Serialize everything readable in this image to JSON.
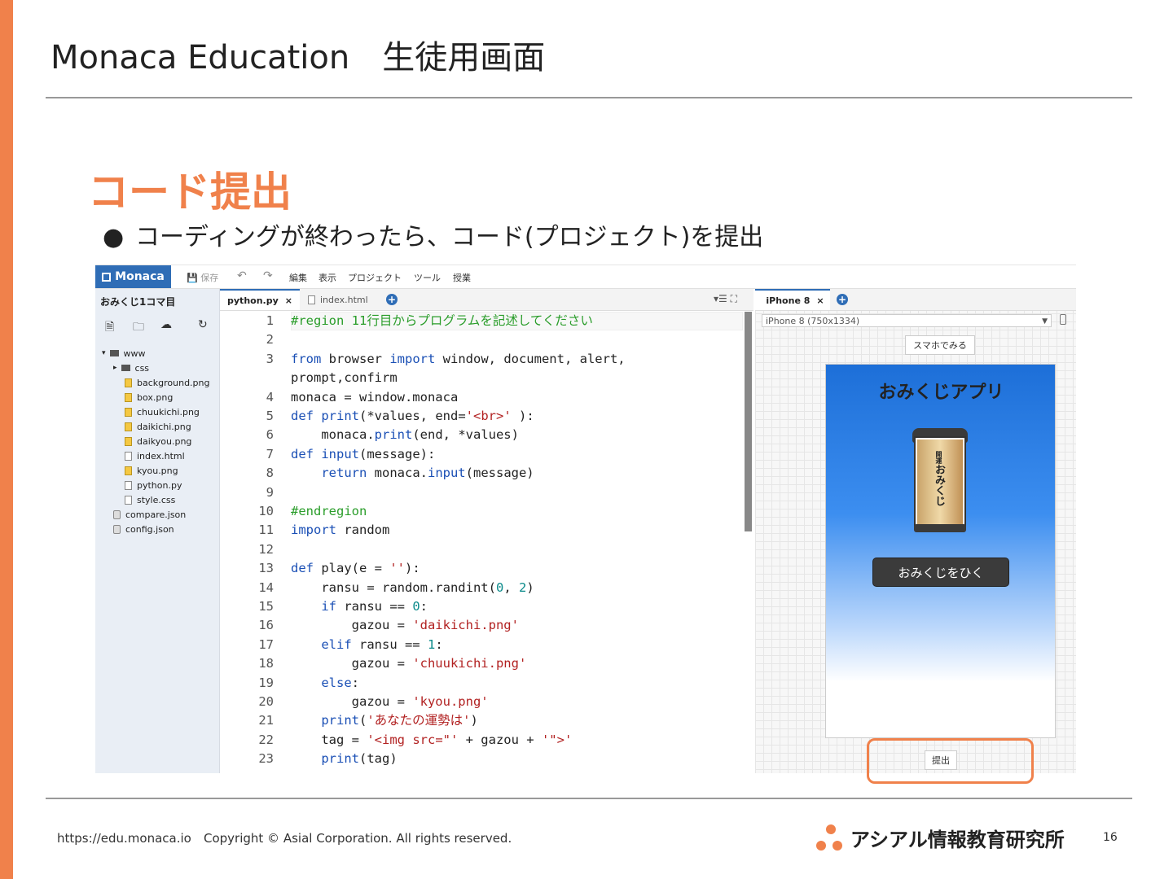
{
  "slide": {
    "title": "Monaca Education　生徒用画面",
    "section_title": "コード提出",
    "bullet": "コーディングが終わったら、コード(プロジェクト)を提出",
    "bullet_mark": "●",
    "page_number": "16"
  },
  "footer": {
    "url": "https://edu.monaca.io",
    "copyright": "Copyright © Asial Corporation. All rights reserved.",
    "logo_text": "アシアル情報教育研究所"
  },
  "ide": {
    "brand": "Monaca",
    "save_label": "保存",
    "menu": [
      "編集",
      "表示",
      "プロジェクト",
      "ツール",
      "授業"
    ],
    "project_name": "おみくじ1コマ目",
    "tree": [
      {
        "name": "www",
        "type": "folder",
        "depth": 0
      },
      {
        "name": "css",
        "type": "folder",
        "depth": 1
      },
      {
        "name": "background.png",
        "type": "img",
        "depth": 2
      },
      {
        "name": "box.png",
        "type": "img",
        "depth": 2
      },
      {
        "name": "chuukichi.png",
        "type": "img",
        "depth": 2
      },
      {
        "name": "daikichi.png",
        "type": "img",
        "depth": 2
      },
      {
        "name": "daikyou.png",
        "type": "img",
        "depth": 2
      },
      {
        "name": "index.html",
        "type": "file",
        "depth": 2
      },
      {
        "name": "kyou.png",
        "type": "img",
        "depth": 2
      },
      {
        "name": "python.py",
        "type": "file",
        "depth": 2
      },
      {
        "name": "style.css",
        "type": "file",
        "depth": 2
      },
      {
        "name": "compare.json",
        "type": "gear",
        "depth": 1
      },
      {
        "name": "config.json",
        "type": "gear",
        "depth": 1
      }
    ],
    "tabs": [
      {
        "label": "python.py",
        "close": "×"
      },
      {
        "label": "index.html"
      }
    ],
    "code": [
      {
        "n": "1",
        "html": "<span class=\"cm\">#region 11行目からプログラムを記述してください</span>"
      },
      {
        "n": "2",
        "html": ""
      },
      {
        "n": "3",
        "html": "<span class=\"kw\">from</span> browser <span class=\"kw\">import</span> window, document, alert,"
      },
      {
        "n": "",
        "html": "prompt,confirm"
      },
      {
        "n": "4",
        "html": "monaca = window.monaca"
      },
      {
        "n": "5",
        "html": "<span class=\"kw\">def</span> <span class=\"kw\">print</span>(*values, end=<span class=\"st\">'&lt;br&gt;'</span> ):"
      },
      {
        "n": "6",
        "html": "    monaca.<span class=\"kw\">print</span>(end, *values)"
      },
      {
        "n": "7",
        "html": "<span class=\"kw\">def</span> <span class=\"kw\">input</span>(message):"
      },
      {
        "n": "8",
        "html": "    <span class=\"kw\">return</span> monaca.<span class=\"kw\">input</span>(message)"
      },
      {
        "n": "9",
        "html": ""
      },
      {
        "n": "10",
        "html": "<span class=\"cm\">#endregion</span>"
      },
      {
        "n": "11",
        "html": "<span class=\"kw\">import</span> random"
      },
      {
        "n": "12",
        "html": ""
      },
      {
        "n": "13",
        "html": "<span class=\"kw\">def</span> play(e = <span class=\"st\">''</span>):"
      },
      {
        "n": "14",
        "html": "    ransu = random.randint(<span class=\"nm\">0</span>, <span class=\"nm\">2</span>)"
      },
      {
        "n": "15",
        "html": "    <span class=\"kw\">if</span> ransu == <span class=\"nm\">0</span>:"
      },
      {
        "n": "16",
        "html": "        gazou = <span class=\"st\">'daikichi.png'</span>"
      },
      {
        "n": "17",
        "html": "    <span class=\"kw\">elif</span> ransu == <span class=\"nm\">1</span>:"
      },
      {
        "n": "18",
        "html": "        gazou = <span class=\"st\">'chuukichi.png'</span>"
      },
      {
        "n": "19",
        "html": "    <span class=\"kw\">else</span>:"
      },
      {
        "n": "20",
        "html": "        gazou = <span class=\"st\">'kyou.png'</span>"
      },
      {
        "n": "21",
        "html": "    <span class=\"kw\">print</span>(<span class=\"st\">'あなたの運勢は'</span>)"
      },
      {
        "n": "22",
        "html": "    tag = <span class=\"st\">'&lt;img src=\"'</span> + gazou + <span class=\"st\">'\"&gt;'</span>"
      },
      {
        "n": "23",
        "html": "    <span class=\"kw\">print</span>(tag)"
      }
    ],
    "preview": {
      "tab_label": "iPhone 8",
      "tab_close": "×",
      "device": "iPhone 8 (750x1334)",
      "view_on_phone": "スマホでみる",
      "app_title": "おみくじアプリ",
      "box_text": "おみくじ",
      "box_small": "開運",
      "draw_button": "おみくじをひく",
      "submit_button": "提出"
    }
  }
}
